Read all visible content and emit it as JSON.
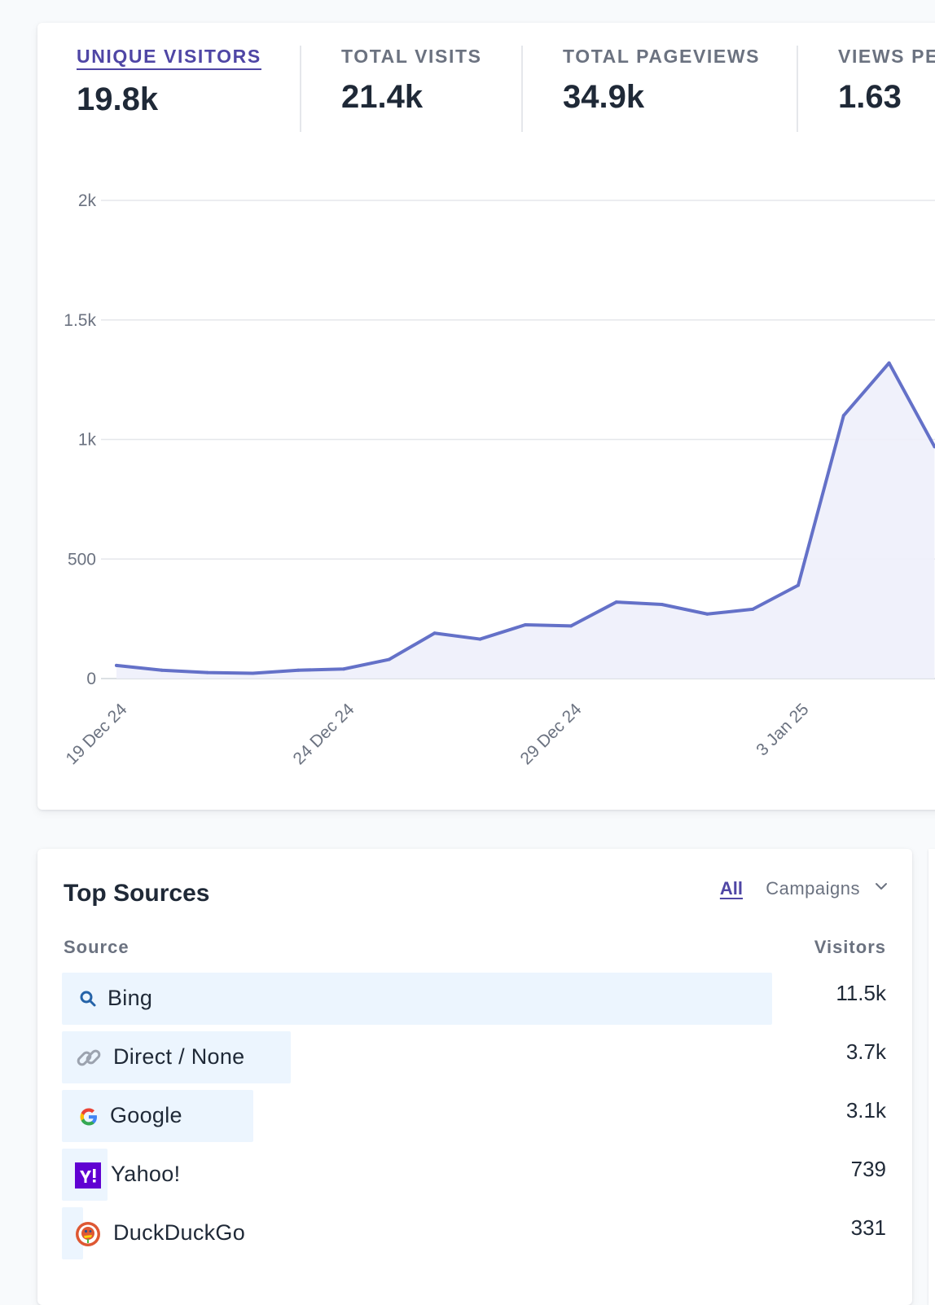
{
  "metrics": [
    {
      "label": "UNIQUE VISITORS",
      "value": "19.8k",
      "active": true
    },
    {
      "label": "TOTAL VISITS",
      "value": "21.4k",
      "active": false
    },
    {
      "label": "TOTAL PAGEVIEWS",
      "value": "34.9k",
      "active": false
    },
    {
      "label": "VIEWS PE",
      "value": "1.63",
      "active": false
    }
  ],
  "chart_data": {
    "type": "area",
    "x": [
      "19 Dec 24",
      "20 Dec 24",
      "21 Dec 24",
      "22 Dec 24",
      "23 Dec 24",
      "24 Dec 24",
      "25 Dec 24",
      "26 Dec 24",
      "27 Dec 24",
      "28 Dec 24",
      "29 Dec 24",
      "30 Dec 24",
      "31 Dec 24",
      "1 Jan 25",
      "2 Jan 25",
      "3 Jan 25",
      "4 Jan 25",
      "5 Jan 25",
      "6 Jan 25"
    ],
    "values": [
      55,
      35,
      25,
      22,
      35,
      40,
      80,
      190,
      165,
      225,
      220,
      320,
      310,
      270,
      290,
      390,
      1100,
      1320,
      970
    ],
    "x_tick_labels": [
      "19 Dec 24",
      "24 Dec 24",
      "29 Dec 24",
      "3 Jan 25"
    ],
    "y_tick_labels": [
      "0",
      "500",
      "1k",
      "1.5k",
      "2k"
    ],
    "ylim": [
      0,
      2000
    ],
    "grid": true,
    "line_color": "#6471c8",
    "fill_color": "#eef0fb"
  },
  "sources": {
    "title": "Top Sources",
    "filter_all": "All",
    "filter_campaigns": "Campaigns",
    "col_source": "Source",
    "col_visitors": "Visitors",
    "rows": [
      {
        "name": "Bing",
        "value": "11.5k",
        "visitors": 11500,
        "icon": "search-icon"
      },
      {
        "name": "Direct / None",
        "value": "3.7k",
        "visitors": 3700,
        "icon": "link-icon"
      },
      {
        "name": "Google",
        "value": "3.1k",
        "visitors": 3100,
        "icon": "google-icon"
      },
      {
        "name": "Yahoo!",
        "value": "739",
        "visitors": 739,
        "icon": "yahoo-icon"
      },
      {
        "name": "DuckDuckGo",
        "value": "331",
        "visitors": 331,
        "icon": "duckduckgo-icon"
      }
    ]
  },
  "colors": {
    "accent": "#4f46a5",
    "bar": "#ecf5fe"
  }
}
